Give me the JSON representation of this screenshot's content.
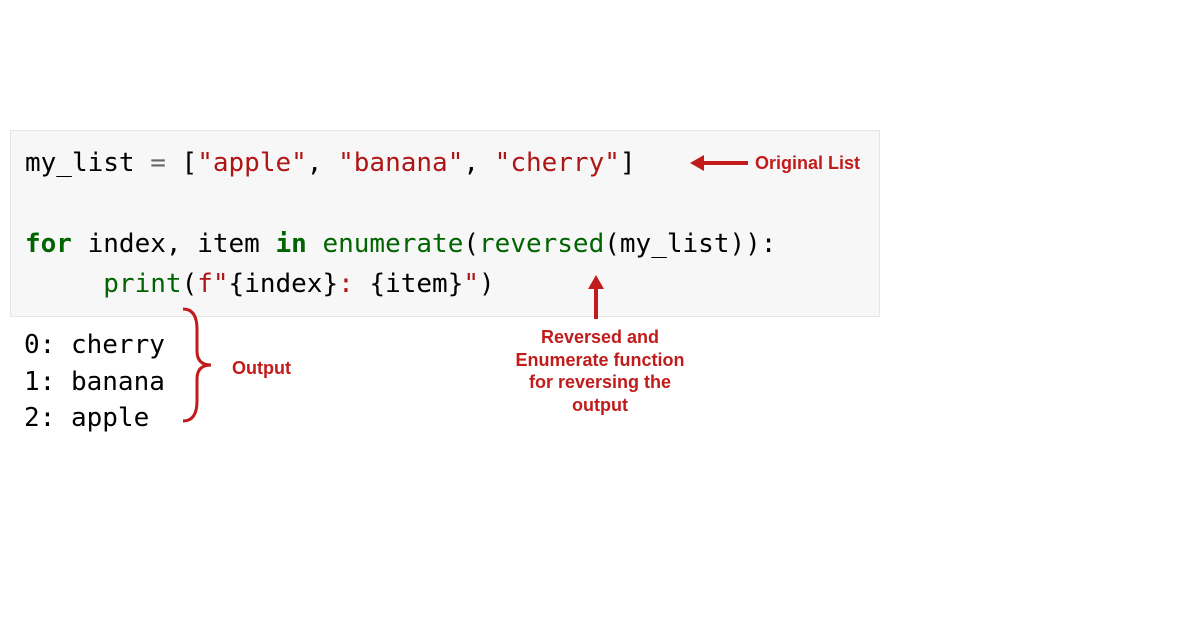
{
  "code": {
    "var": "my_list",
    "eq": " = ",
    "lb": "[",
    "q": "\"",
    "s1": "apple",
    "s2": "banana",
    "s3": "cherry",
    "comma": ", ",
    "rb": "]",
    "kw_for": "for",
    "sp": " ",
    "idx": "index",
    "cm": ",",
    "item": "item",
    "kw_in": "in",
    "fn_enum": "enumerate",
    "lp": "(",
    "fn_rev": "reversed",
    "rp": ")",
    "colon": ":",
    "indent": "     ",
    "fn_print": "print",
    "fstr_open": "f\"",
    "brL": "{",
    "brR": "}",
    "lit_colon_sp": ": ",
    "qclose": "\""
  },
  "output": {
    "l1": "0: cherry",
    "l2": "1: banana",
    "l3": "2: apple"
  },
  "annotations": {
    "orig_list": "Original List",
    "output_label": "Output",
    "rev_enum_1": "Reversed and",
    "rev_enum_2": "Enumerate function",
    "rev_enum_3": "for reversing the",
    "rev_enum_4": "output"
  }
}
